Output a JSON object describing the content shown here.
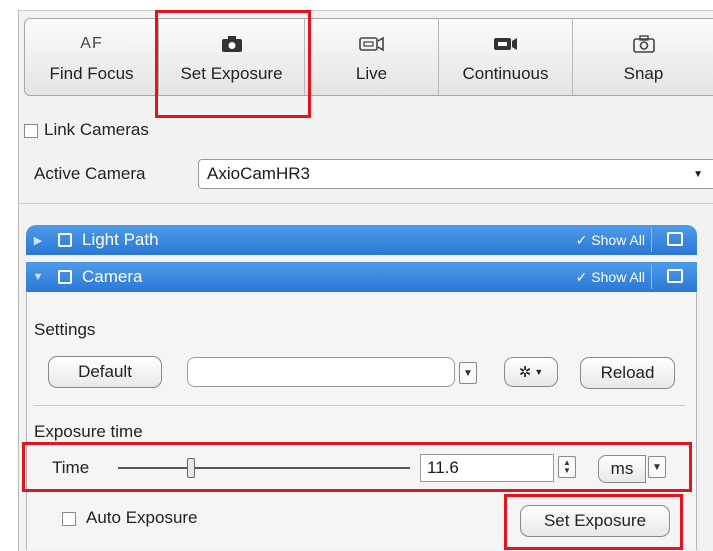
{
  "toolbar": {
    "buttons": [
      {
        "icon_text": "AF",
        "label": "Find Focus"
      },
      {
        "icon": "camera-icon",
        "label": "Set Exposure"
      },
      {
        "icon": "live-camera-icon",
        "label": "Live"
      },
      {
        "icon": "video-camera-icon",
        "label": "Continuous"
      },
      {
        "icon": "snap-camera-icon",
        "label": "Snap"
      }
    ]
  },
  "link_cameras": {
    "label": "Link Cameras",
    "checked": false
  },
  "active_camera": {
    "label": "Active Camera",
    "value": "AxioCamHR3"
  },
  "sections": {
    "light_path": {
      "title": "Light Path",
      "show_all": "✓ Show All",
      "expanded": false
    },
    "camera": {
      "title": "Camera",
      "show_all": "✓ Show All",
      "expanded": true
    }
  },
  "settings": {
    "label": "Settings",
    "default_button": "Default",
    "preset_value": "",
    "reload_button": "Reload"
  },
  "exposure": {
    "section_label": "Exposure time",
    "time_label": "Time",
    "value": "11.6",
    "unit": "ms",
    "auto_label": "Auto Exposure",
    "auto_checked": false,
    "set_button": "Set Exposure"
  },
  "colors": {
    "section_header": "#2a77d6",
    "highlight": "#e4141c"
  }
}
